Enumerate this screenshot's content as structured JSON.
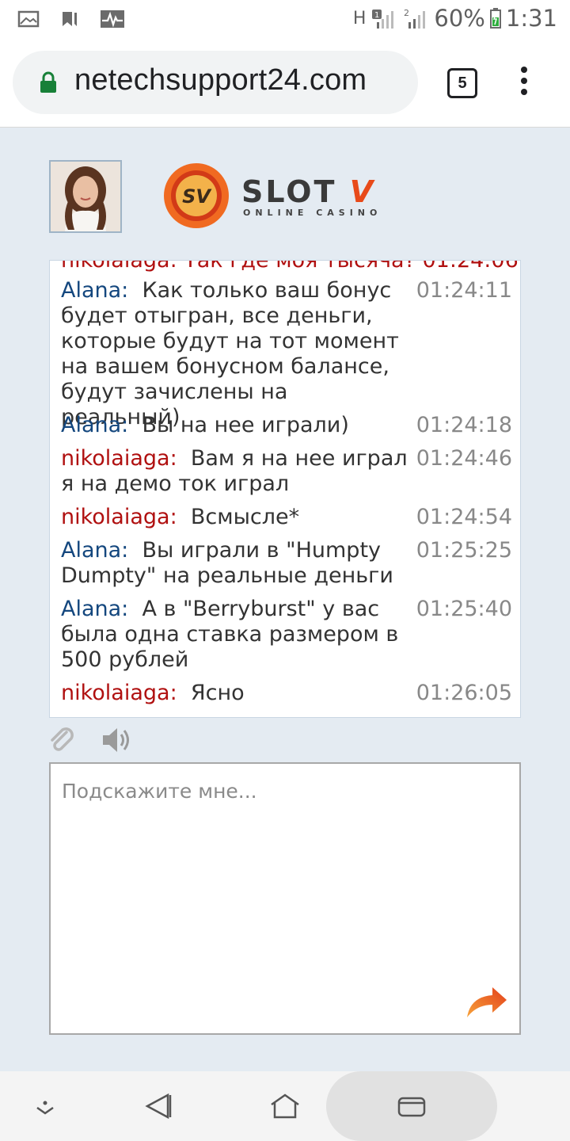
{
  "status_bar": {
    "icons_left": [
      "image-icon",
      "bookmark-icon",
      "activity-icon"
    ],
    "network": "H",
    "battery": "60%",
    "time": "1:31"
  },
  "browser": {
    "url": "netechsupport24.com",
    "tab_count": "5"
  },
  "brand": {
    "logo_main": "SLOT",
    "logo_v": "V",
    "logo_sub": "ONLINE CASINO",
    "logo_badge": "SV"
  },
  "chat": {
    "partial_top": "nikolaiaga: Так где моя тысяча? 01:24:06",
    "messages": [
      {
        "author": "Alana:",
        "text": "Как только ваш бонус будет отыгран, все деньги, которые будут на тот момент на вашем бонусном балансе, будут зачислены на реальный)",
        "time": "01:24:11"
      },
      {
        "author": "Alana:",
        "text": "Вы на нее играли)",
        "time": "01:24:18"
      },
      {
        "author": "nikolaiaga:",
        "text": "Вам я на нее играл я на демо ток играл",
        "time": "01:24:46"
      },
      {
        "author": "nikolaiaga:",
        "text": "Всмысле*",
        "time": "01:24:54"
      },
      {
        "author": "Alana:",
        "text": "Вы играли в \"Humpty Dumpty\" на реальные деньги",
        "time": "01:25:25"
      },
      {
        "author": "Alana:",
        "text": "А в \"Berryburst\" у вас была одна ставка размером в 500 рублей",
        "time": "01:25:40"
      },
      {
        "author": "nikolaiaga:",
        "text": "Ясно",
        "time": "01:26:05"
      }
    ]
  },
  "input": {
    "placeholder": "Подскажите мне..."
  },
  "colors": {
    "agent": "#14477e",
    "user": "#b01010",
    "accent": "#e84a1a"
  }
}
